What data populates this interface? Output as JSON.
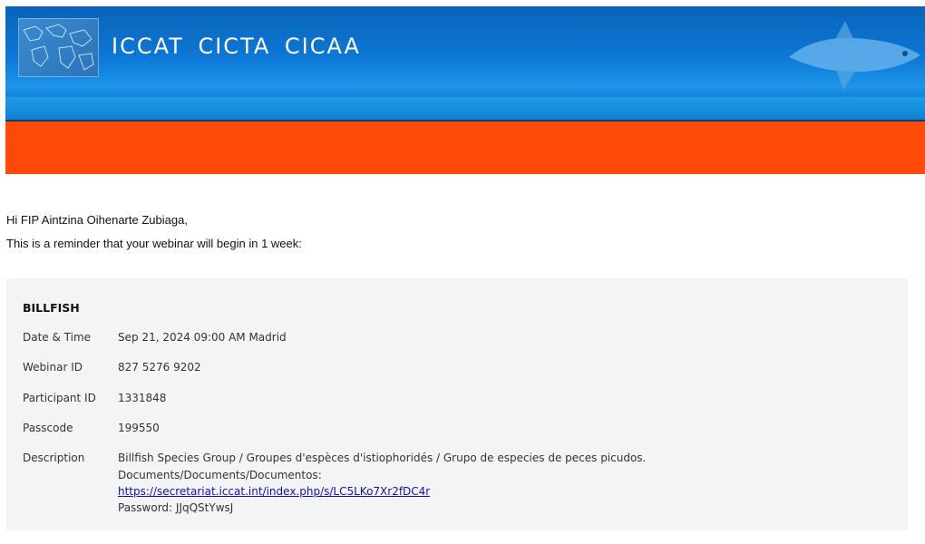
{
  "header": {
    "org_name": "ICCAT  CICTA  CICAA"
  },
  "email": {
    "greeting": "Hi FIP Aintzina Oihenarte Zubiaga,",
    "intro": "This is a reminder that your webinar will begin in 1 week:"
  },
  "webinar": {
    "title": "BILLFISH",
    "rows": [
      {
        "label": "Date & Time",
        "value": "Sep 21, 2024 09:00 AM Madrid"
      },
      {
        "label": "Webinar ID",
        "value": "827 5276 9202"
      },
      {
        "label": "Participant ID",
        "value": "1331848"
      },
      {
        "label": "Passcode",
        "value": "199550"
      }
    ],
    "description": {
      "label": "Description",
      "line1": "Billfish Species Group / Groupes d'espèces d'istiophoridés / Grupo de especies de peces picudos.",
      "line2": "Documents/Documents/Documentos:",
      "link": "https://secretariat.iccat.int/index.php/s/LC5LKo7Xr2fDC4r",
      "line4": "Password: JJqQStYwsJ"
    }
  },
  "colors": {
    "banner_blue": "#0d78d6",
    "accent_orange": "#ff4a0a",
    "link": "#1a0dab"
  }
}
